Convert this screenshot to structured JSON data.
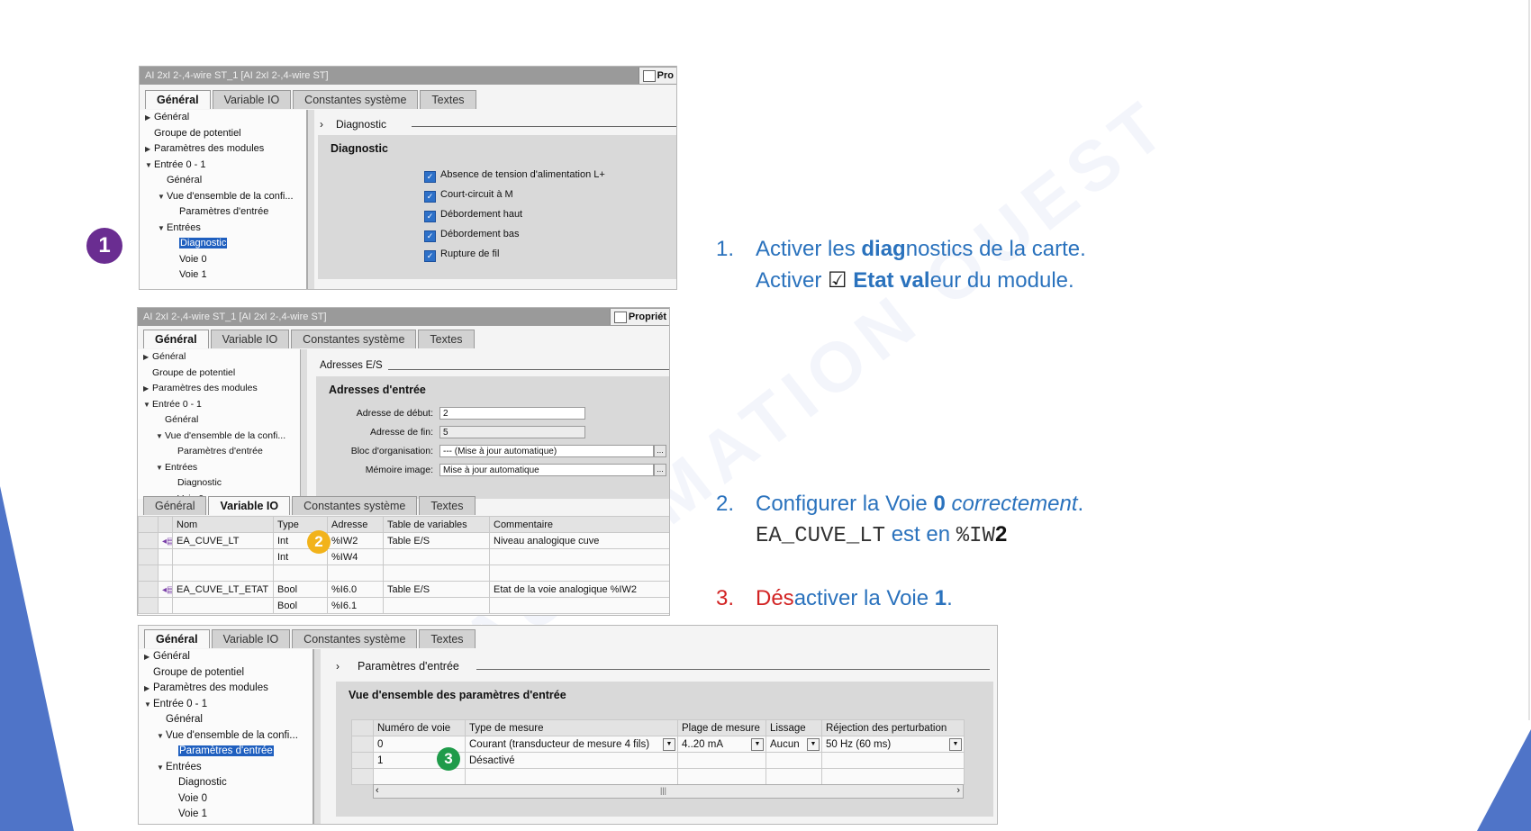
{
  "panel1": {
    "title": "AI 2xI 2-,4-wire ST_1 [AI 2xI 2-,4-wire ST]",
    "prop_label": "Pro",
    "tabs": [
      "Général",
      "Variable IO",
      "Constantes système",
      "Textes"
    ],
    "tree": [
      {
        "label": "Général",
        "arrow": "right"
      },
      {
        "label": "Groupe de potentiel",
        "arrow": ""
      },
      {
        "label": "Paramètres des modules",
        "arrow": "right"
      },
      {
        "label": "Entrée 0 - 1",
        "arrow": "down"
      },
      {
        "label": "Général",
        "arrow": ""
      },
      {
        "label": "Vue d'ensemble de la confi...",
        "arrow": "down"
      },
      {
        "label": "Paramètres d'entrée",
        "arrow": ""
      },
      {
        "label": "Entrées",
        "arrow": "down"
      },
      {
        "label": "Diagnostic",
        "arrow": "",
        "selected": true
      },
      {
        "label": "Voie 0",
        "arrow": ""
      },
      {
        "label": "Voie 1",
        "arrow": ""
      }
    ],
    "section_label": "Diagnostic",
    "box_heading": "Diagnostic",
    "checkboxes": [
      "Absence de tension d'alimentation L+",
      "Court-circuit à M",
      "Débordement haut",
      "Débordement bas",
      "Rupture de fil"
    ]
  },
  "panel2": {
    "title": "AI 2xI 2-,4-wire ST_1 [AI 2xI 2-,4-wire ST]",
    "prop_label": "Propriét",
    "tabs": [
      "Général",
      "Variable IO",
      "Constantes système",
      "Textes"
    ],
    "tree": [
      {
        "label": "Général",
        "arrow": "right"
      },
      {
        "label": "Groupe de potentiel",
        "arrow": ""
      },
      {
        "label": "Paramètres des modules",
        "arrow": "right"
      },
      {
        "label": "Entrée 0 - 1",
        "arrow": "down"
      },
      {
        "label": "Général",
        "arrow": ""
      },
      {
        "label": "Vue d'ensemble de la confi...",
        "arrow": "down"
      },
      {
        "label": "Paramètres d'entrée",
        "arrow": ""
      },
      {
        "label": "Entrées",
        "arrow": "down"
      },
      {
        "label": "Diagnostic",
        "arrow": ""
      },
      {
        "label": "Voie 0",
        "arrow": ""
      }
    ],
    "section_label": "Adresses E/S",
    "box_heading": "Adresses d'entrée",
    "fields": [
      {
        "label": "Adresse de début:",
        "value": "2"
      },
      {
        "label": "Adresse de fin:",
        "value": "5"
      },
      {
        "label": "Bloc d'organisation:",
        "value": "--- (Mise à jour automatique)"
      },
      {
        "label": "Mémoire image:",
        "value": "Mise à jour automatique"
      }
    ],
    "io_tabs": [
      "Général",
      "Variable IO",
      "Constantes système",
      "Textes"
    ],
    "io_columns": [
      "Nom",
      "Type",
      "Adresse",
      "Table de variables",
      "Commentaire"
    ],
    "io_rows": [
      {
        "name": "EA_CUVE_LT",
        "type": "Int",
        "address": "%IW2",
        "table": "Table E/S",
        "comment": "Niveau analogique cuve"
      },
      {
        "name": "",
        "type": "Int",
        "address": "%IW4",
        "table": "",
        "comment": ""
      },
      {
        "name": "",
        "type": "",
        "address": "",
        "table": "",
        "comment": ""
      },
      {
        "name": "EA_CUVE_LT_ETAT",
        "type": "Bool",
        "address": "%I6.0",
        "table": "Table E/S",
        "comment": "Etat de la voie analogique %IW2"
      },
      {
        "name": "",
        "type": "Bool",
        "address": "%I6.1",
        "table": "",
        "comment": ""
      }
    ]
  },
  "panel3": {
    "tabs": [
      "Général",
      "Variable IO",
      "Constantes système",
      "Textes"
    ],
    "tree": [
      {
        "label": "Général",
        "arrow": "right"
      },
      {
        "label": "Groupe de potentiel",
        "arrow": ""
      },
      {
        "label": "Paramètres des modules",
        "arrow": "right"
      },
      {
        "label": "Entrée 0 - 1",
        "arrow": "down"
      },
      {
        "label": "Général",
        "arrow": ""
      },
      {
        "label": "Vue d'ensemble de la confi...",
        "arrow": "down"
      },
      {
        "label": "Paramètres d'entrée",
        "arrow": "",
        "selected": true
      },
      {
        "label": "Entrées",
        "arrow": "down"
      },
      {
        "label": "Diagnostic",
        "arrow": ""
      },
      {
        "label": "Voie 0",
        "arrow": ""
      },
      {
        "label": "Voie 1",
        "arrow": ""
      }
    ],
    "section_label": "Paramètres d'entrée",
    "box_heading": "Vue d'ensemble des paramètres d'entrée",
    "columns": [
      "Numéro de voie",
      "Type de mesure",
      "Plage de mesure",
      "Lissage",
      "Réjection des perturbation"
    ],
    "rows": [
      {
        "channel": "0",
        "type": "Courant (transducteur de mesure 4 fils)",
        "range": "4..20 mA",
        "smoothing": "Aucun",
        "rejection": "50 Hz (60 ms)"
      },
      {
        "channel": "1",
        "type": "Désactivé",
        "range": "",
        "smoothing": "",
        "rejection": ""
      }
    ]
  },
  "badges": {
    "b1": "1",
    "b2": "2",
    "b3": "3"
  },
  "instructions": {
    "i1_num": "1.",
    "i1_a": "Activer les ",
    "i1_b": "diag",
    "i1_c": "nostics de la carte.",
    "i1_d": "Activer ",
    "i1_check": "☑",
    "i1_e": " Etat val",
    "i1_f": "eur du module.",
    "i2_num": "2.",
    "i2_a": "Configurer la Voie ",
    "i2_b": "0",
    "i2_c": " correctement",
    "i2_d": ".",
    "i2_mono1": "EA_CUVE_LT",
    "i2_e": " est en ",
    "i2_mono2": "%IW",
    "i2_f": "2",
    "i3_num": "3.",
    "i3_red": "Dés",
    "i3_a": "activer la Voie ",
    "i3_b": "1",
    "i3_c": "."
  },
  "colors": {
    "accent_blue": "#2a72bd",
    "red": "#d22323",
    "badge_purple": "#6a2d91",
    "badge_yellow": "#f2b31b",
    "badge_green": "#1f9b4a",
    "selection": "#1f5fbf"
  }
}
